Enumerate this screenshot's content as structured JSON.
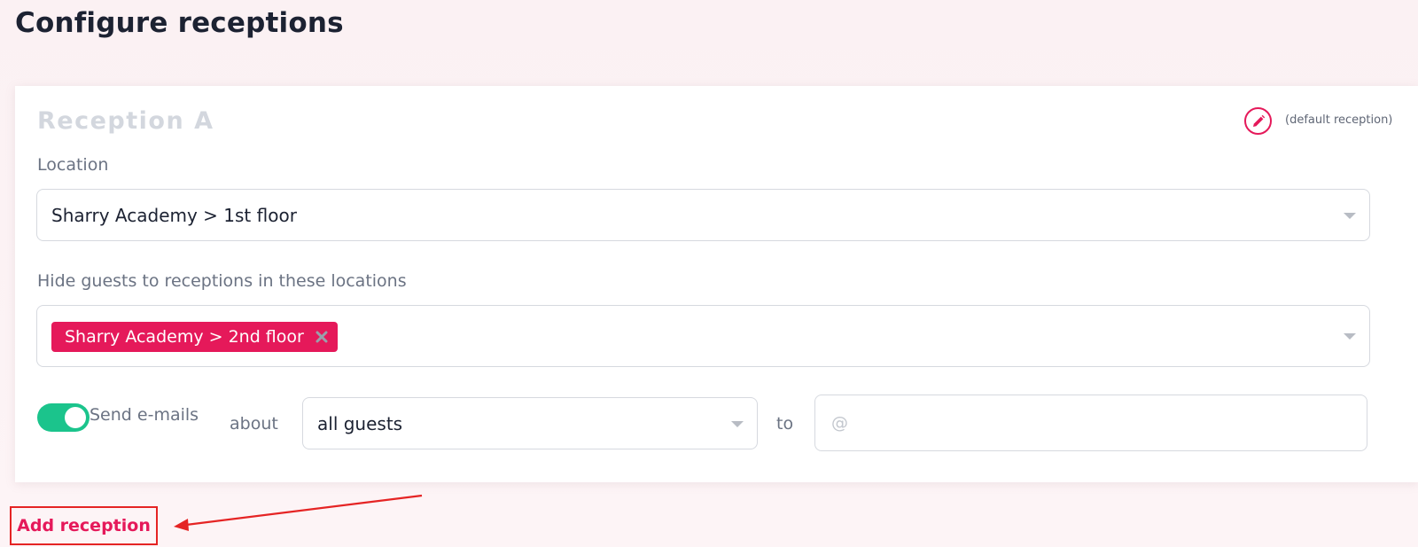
{
  "page": {
    "title": "Configure receptions"
  },
  "reception": {
    "name": "Reception A",
    "default_tag": "(default reception)",
    "edit_icon": "pencil-icon",
    "location": {
      "label": "Location",
      "value": "Sharry Academy > 1st floor"
    },
    "hide_guests": {
      "label": "Hide guests to receptions in these locations",
      "chips": [
        "Sharry Academy > 2nd floor"
      ],
      "chip_remove_icon": "close-icon"
    },
    "emails": {
      "toggle_on": true,
      "toggle_label": "Send e-mails",
      "about_label": "about",
      "about_value": "all guests",
      "to_label": "to",
      "to_placeholder": "@",
      "to_value": ""
    }
  },
  "actions": {
    "add_reception_label": "Add reception"
  },
  "colors": {
    "accent": "#e5195a",
    "toggle_on": "#1bc48c",
    "annotation_red": "#e52424"
  }
}
